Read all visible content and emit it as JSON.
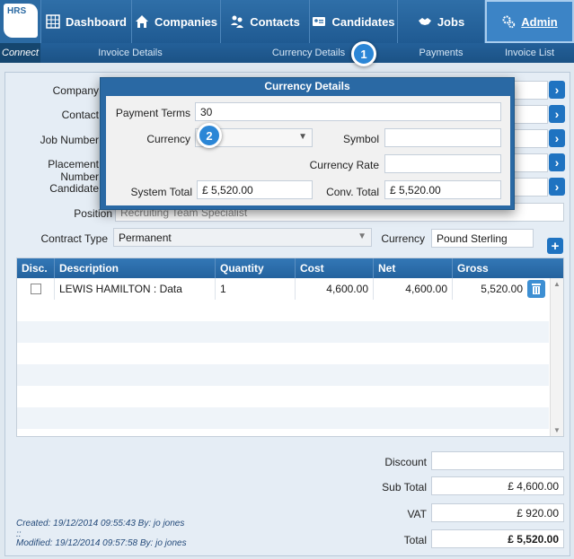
{
  "logo": {
    "text": "HRS"
  },
  "nav": {
    "items": [
      {
        "label": "Dashboard"
      },
      {
        "label": "Companies"
      },
      {
        "label": "Contacts"
      },
      {
        "label": "Candidates"
      },
      {
        "label": "Jobs"
      },
      {
        "label": "Admin"
      }
    ]
  },
  "subnav": {
    "connect": "Connect",
    "items": [
      "Invoice Details",
      "Currency Details",
      "Payments",
      "Invoice List"
    ]
  },
  "form": {
    "company_label": "Company",
    "contact_label": "Contact",
    "job_number_label": "Job Number",
    "placement_number_label": "Placement Number",
    "candidate_label": "Candidate",
    "position_label": "Position",
    "position_value": "Recruiting Team Specialist",
    "contract_type_label": "Contract Type",
    "contract_type_value": "Permanent",
    "currency_label": "Currency",
    "currency_value": "Pound Sterling"
  },
  "modal": {
    "title": "Currency Details",
    "payment_terms_label": "Payment Terms",
    "payment_terms_value": "30",
    "currency_label": "Currency",
    "currency_value": "",
    "symbol_label": "Symbol",
    "symbol_value": "",
    "currency_rate_label": "Currency Rate",
    "currency_rate_value": "",
    "system_total_label": "System Total",
    "system_total_value": "£ 5,520.00",
    "conv_total_label": "Conv. Total",
    "conv_total_value": "£ 5,520.00"
  },
  "callouts": [
    "1",
    "2"
  ],
  "table": {
    "headers": [
      "Disc.",
      "Description",
      "Quantity",
      "Cost",
      "Net",
      "Gross"
    ],
    "rows": [
      {
        "description": "LEWIS HAMILTON : Data",
        "quantity": "1",
        "cost": "4,600.00",
        "net": "4,600.00",
        "gross": "5,520.00"
      }
    ]
  },
  "totals": {
    "discount_label": "Discount",
    "discount_value": "",
    "subtotal_label": "Sub Total",
    "subtotal_value": "£ 4,600.00",
    "vat_label": "VAT",
    "vat_value": "£ 920.00",
    "total_label": "Total",
    "total_value": "£ 5,520.00"
  },
  "footer": {
    "created": "Created: 19/12/2014 09:55:43 By: jo jones",
    "separator": "::",
    "modified": "Modified: 19/12/2014 09:57:58 By: jo jones"
  },
  "colors": {
    "nav_blue": "#2f6fa8",
    "accent_blue": "#1f73c1",
    "callout_blue": "#2b86d6"
  }
}
